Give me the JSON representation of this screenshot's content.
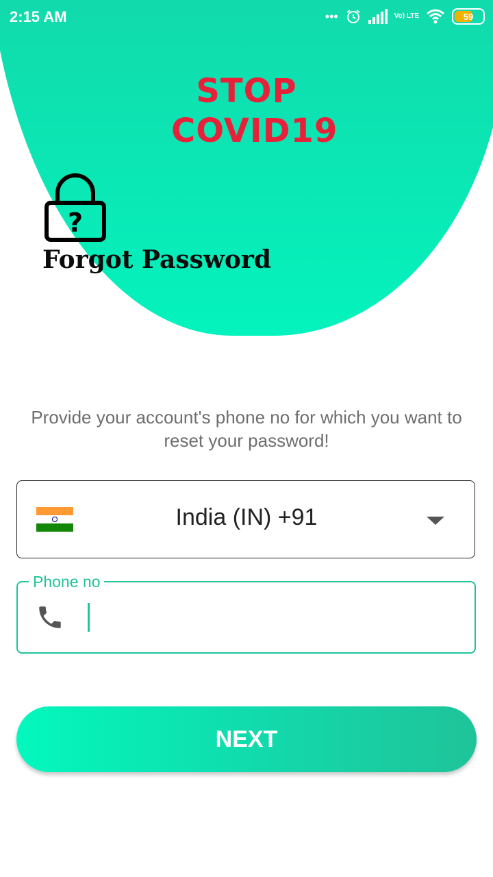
{
  "status_bar": {
    "time": "2:15 AM",
    "signal_label": "Vo) LTE",
    "battery_level": "59",
    "icons": [
      "dots-icon",
      "alarm-icon",
      "signal-icon",
      "volte-icon",
      "wifi-icon",
      "battery-icon"
    ]
  },
  "logo": {
    "line1": "STOP",
    "line2": "COVID19"
  },
  "header": {
    "title": "Forgot Password",
    "icon": "lock-question-icon"
  },
  "instruction": "Provide your account's phone no for which you want to reset your password!",
  "country_select": {
    "selected": "India (IN)  +91",
    "flag": "india-flag"
  },
  "phone_field": {
    "label": "Phone no",
    "value": "",
    "icon": "phone-icon"
  },
  "actions": {
    "next_label": "NEXT"
  },
  "colors": {
    "accent": "#20c39a",
    "gradient_start": "#03f8bd",
    "logo_red": "#e8213a"
  }
}
